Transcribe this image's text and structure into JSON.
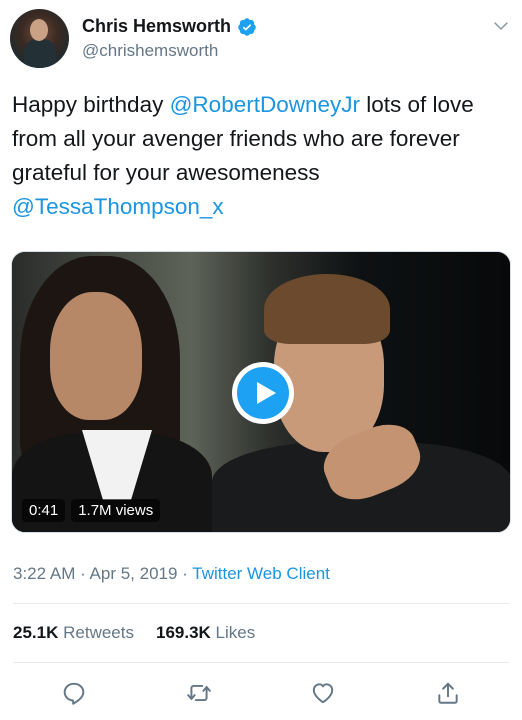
{
  "header": {
    "display_name": "Chris Hemsworth",
    "handle": "@chrishemsworth",
    "verified_icon": "verified-badge-icon",
    "menu_icon": "chevron-down-icon"
  },
  "tweet": {
    "text_1": "Happy birthday ",
    "mention_1": "@RobertDowneyJr",
    "text_2": " lots of love from all your avenger friends who are forever grateful for your awesomeness ",
    "mention_2": "@TessaThompson_x"
  },
  "media": {
    "duration": "0:41",
    "views": "1.7M views",
    "play_icon": "play-icon"
  },
  "meta": {
    "time": "3:22 AM",
    "separator_1": " · ",
    "date": "Apr 5, 2019",
    "separator_2": " · ",
    "client": "Twitter Web Client"
  },
  "stats": {
    "retweets_count": "25.1K",
    "retweets_label": "Retweets",
    "likes_count": "169.3K",
    "likes_label": "Likes"
  },
  "actions": [
    "reply-icon",
    "retweet-icon",
    "like-icon",
    "share-icon"
  ],
  "colors": {
    "accent": "#1b95e0",
    "text": "#14171a",
    "secondary": "#657786",
    "divider": "#e6ecf0"
  }
}
